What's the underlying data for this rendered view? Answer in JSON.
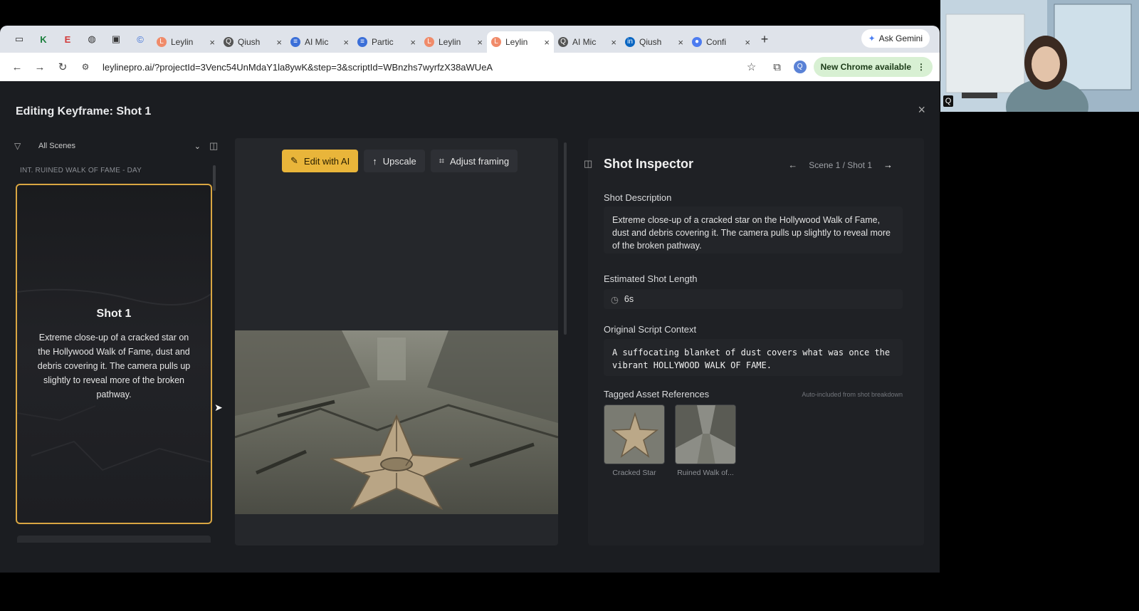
{
  "browser": {
    "tabs": [
      {
        "label": "Leylin",
        "fav_color": "#f08b6a",
        "fav_glyph": "L"
      },
      {
        "label": "Qiush",
        "fav_color": "#555",
        "fav_glyph": "Q"
      },
      {
        "label": "AI Mic",
        "fav_color": "#3b6fd8",
        "fav_glyph": "≡"
      },
      {
        "label": "Partic",
        "fav_color": "#3b6fd8",
        "fav_glyph": "≡"
      },
      {
        "label": "Leylin",
        "fav_color": "#f08b6a",
        "fav_glyph": "L"
      },
      {
        "label": "Leylin",
        "fav_color": "#f08b6a",
        "fav_glyph": "L"
      },
      {
        "label": "AI Mic",
        "fav_color": "#555",
        "fav_glyph": "Q"
      },
      {
        "label": "Qiush",
        "fav_color": "#0a66c2",
        "fav_glyph": "in"
      },
      {
        "label": "Confi",
        "fav_color": "#4d7cf0",
        "fav_glyph": "●"
      }
    ],
    "active_tab_index": 5,
    "ask_gemini": "Ask Gemini",
    "url": "leylinepro.ai/?projectId=3Venc54UnMdaY1la8ywK&step=3&scriptId=WBnzhs7wyrfzX38aWUeA",
    "update_label": "New Chrome available",
    "profile_initial": "Q"
  },
  "modal": {
    "title": "Editing Keyframe: Shot 1",
    "close": "×"
  },
  "left": {
    "filter_value": "All Scenes",
    "scene_heading": "INT. RUINED WALK OF FAME - DAY",
    "card": {
      "title": "Shot 1",
      "description": "Extreme close-up of a cracked star on the Hollywood Walk of Fame, dust and debris covering it. The camera pulls up slightly to reveal more of the broken pathway."
    }
  },
  "toolbar": {
    "edit_ai": "Edit with AI",
    "upscale": "Upscale",
    "adjust": "Adjust framing"
  },
  "inspector": {
    "title": "Shot Inspector",
    "position": "Scene 1 / Shot 1",
    "desc_label": "Shot Description",
    "desc_text": "Extreme close-up of a cracked star on the Hollywood Walk of Fame, dust and debris covering it. The camera pulls up slightly to reveal more of the broken pathway.",
    "length_label": "Estimated Shot Length",
    "length_value": "6s",
    "context_label": "Original Script Context",
    "context_text": "A suffocating blanket of dust covers what was once the vibrant HOLLYWOOD WALK OF FAME.",
    "assets_label": "Tagged Asset References",
    "assets_note": "Auto-included from shot breakdown",
    "assets": [
      {
        "caption": "Cracked Star"
      },
      {
        "caption": "Ruined Walk of..."
      }
    ]
  },
  "webcam": {
    "label": "Q"
  },
  "colors": {
    "accent": "#e9b53a",
    "card_border": "#d9a642",
    "background": "#1b1d21"
  }
}
